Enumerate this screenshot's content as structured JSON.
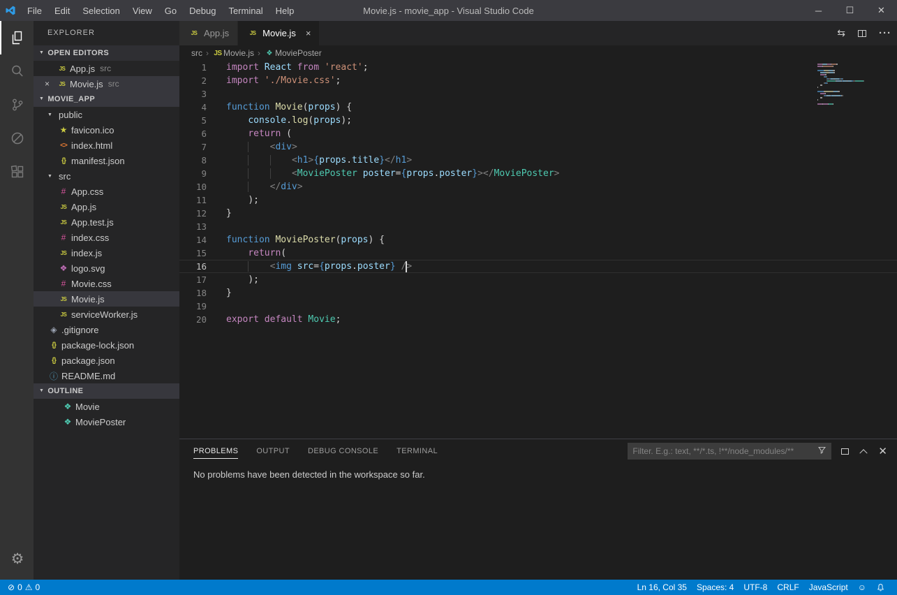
{
  "colors": {
    "accent": "#007acc",
    "editor_background": "#1e1e1e",
    "sidebar_background": "#252526",
    "activitybar_background": "#333333",
    "titlebar_background": "#3b3b40",
    "statusbar_background": "#007acc",
    "selection_background": "#37373d"
  },
  "title_bar": {
    "title": "Movie.js - movie_app - Visual Studio Code",
    "menus": [
      "File",
      "Edit",
      "Selection",
      "View",
      "Go",
      "Debug",
      "Terminal",
      "Help"
    ]
  },
  "activity_bar": {
    "items": [
      {
        "name": "explorer",
        "active": true
      },
      {
        "name": "search",
        "active": false
      },
      {
        "name": "source-control",
        "active": false
      },
      {
        "name": "debug",
        "active": false
      },
      {
        "name": "extensions",
        "active": false
      }
    ],
    "bottom": [
      {
        "name": "settings"
      }
    ]
  },
  "sidebar": {
    "title": "EXPLORER",
    "open_editors": {
      "label": "OPEN EDITORS",
      "items": [
        {
          "icon": "js",
          "label": "App.js",
          "path": "src",
          "selected": false,
          "close_visible": false
        },
        {
          "icon": "js",
          "label": "Movie.js",
          "path": "src",
          "selected": true,
          "close_visible": true
        }
      ]
    },
    "workspace": {
      "label": "MOVIE_APP",
      "items": [
        {
          "type": "folder",
          "label": "public",
          "indent": 0,
          "expanded": true
        },
        {
          "type": "file",
          "icon": "star",
          "label": "favicon.ico",
          "indent": 1
        },
        {
          "type": "file",
          "icon": "html",
          "label": "index.html",
          "indent": 1
        },
        {
          "type": "file",
          "icon": "json",
          "label": "manifest.json",
          "indent": 1
        },
        {
          "type": "folder",
          "label": "src",
          "indent": 0,
          "expanded": true
        },
        {
          "type": "file",
          "icon": "css",
          "label": "App.css",
          "indent": 1
        },
        {
          "type": "file",
          "icon": "js",
          "label": "App.js",
          "indent": 1
        },
        {
          "type": "file",
          "icon": "js",
          "label": "App.test.js",
          "indent": 1
        },
        {
          "type": "file",
          "icon": "css",
          "label": "index.css",
          "indent": 1
        },
        {
          "type": "file",
          "icon": "js",
          "label": "index.js",
          "indent": 1
        },
        {
          "type": "file",
          "icon": "svg",
          "label": "logo.svg",
          "indent": 1
        },
        {
          "type": "file",
          "icon": "css",
          "label": "Movie.css",
          "indent": 1
        },
        {
          "type": "file",
          "icon": "js",
          "label": "Movie.js",
          "indent": 1,
          "selected": true
        },
        {
          "type": "file",
          "icon": "js",
          "label": "serviceWorker.js",
          "indent": 1
        },
        {
          "type": "file",
          "icon": "git",
          "label": ".gitignore",
          "indent": 0
        },
        {
          "type": "file",
          "icon": "json",
          "label": "package-lock.json",
          "indent": 0
        },
        {
          "type": "file",
          "icon": "json",
          "label": "package.json",
          "indent": 0
        },
        {
          "type": "file",
          "icon": "info",
          "label": "README.md",
          "indent": 0
        }
      ]
    },
    "outline": {
      "label": "OUTLINE",
      "items": [
        {
          "icon": "symbol",
          "label": "Movie"
        },
        {
          "icon": "symbol",
          "label": "MoviePoster"
        }
      ]
    }
  },
  "editor": {
    "tabs": [
      {
        "icon": "js",
        "label": "App.js",
        "active": false,
        "close_visible": false
      },
      {
        "icon": "js",
        "label": "Movie.js",
        "active": true,
        "close_visible": true
      }
    ],
    "actions": [
      "open-changes",
      "split-editor",
      "more-actions"
    ],
    "breadcrumbs": [
      {
        "label": "src"
      },
      {
        "icon": "js",
        "label": "Movie.js"
      },
      {
        "icon": "symbol",
        "label": "MoviePoster"
      }
    ],
    "cursor": {
      "line": 16,
      "col": 35
    },
    "token_colors": {
      "k": "#c586c0",
      "b": "#569cd6",
      "f": "#dcdcaa",
      "v": "#9cdcfe",
      "s": "#ce9178",
      "c": "#4ec9b0",
      "g": "#808080",
      "d": "#d4d4d4"
    },
    "code": [
      {
        "n": 1,
        "t": [
          [
            "k",
            "import"
          ],
          [
            "d",
            " "
          ],
          [
            "v",
            "React"
          ],
          [
            "d",
            " "
          ],
          [
            "k",
            "from"
          ],
          [
            "d",
            " "
          ],
          [
            "s",
            "'react'"
          ],
          [
            "d",
            ";"
          ]
        ]
      },
      {
        "n": 2,
        "t": [
          [
            "k",
            "import"
          ],
          [
            "d",
            " "
          ],
          [
            "s",
            "'./Movie.css'"
          ],
          [
            "d",
            ";"
          ]
        ]
      },
      {
        "n": 3,
        "t": []
      },
      {
        "n": 4,
        "t": [
          [
            "b",
            "function"
          ],
          [
            "d",
            " "
          ],
          [
            "f",
            "Movie"
          ],
          [
            "d",
            "("
          ],
          [
            "v",
            "props"
          ],
          [
            "d",
            ") {"
          ]
        ]
      },
      {
        "n": 5,
        "t": [
          [
            "w",
            "    "
          ],
          [
            "v",
            "console"
          ],
          [
            "d",
            "."
          ],
          [
            "f",
            "log"
          ],
          [
            "d",
            "("
          ],
          [
            "v",
            "props"
          ],
          [
            "d",
            ");"
          ]
        ]
      },
      {
        "n": 6,
        "t": [
          [
            "w",
            "    "
          ],
          [
            "k",
            "return"
          ],
          [
            "d",
            " ("
          ]
        ]
      },
      {
        "n": 7,
        "t": [
          [
            "w",
            "        "
          ],
          [
            "g",
            "<"
          ],
          [
            "b",
            "div"
          ],
          [
            "g",
            ">"
          ]
        ]
      },
      {
        "n": 8,
        "t": [
          [
            "w",
            "            "
          ],
          [
            "g",
            "<"
          ],
          [
            "b",
            "h1"
          ],
          [
            "g",
            ">"
          ],
          [
            "b",
            "{"
          ],
          [
            "v",
            "props"
          ],
          [
            "d",
            "."
          ],
          [
            "v",
            "title"
          ],
          [
            "b",
            "}"
          ],
          [
            "g",
            "</"
          ],
          [
            "b",
            "h1"
          ],
          [
            "g",
            ">"
          ]
        ]
      },
      {
        "n": 9,
        "t": [
          [
            "w",
            "            "
          ],
          [
            "g",
            "<"
          ],
          [
            "c",
            "MoviePoster"
          ],
          [
            "d",
            " "
          ],
          [
            "v",
            "poster"
          ],
          [
            "d",
            "="
          ],
          [
            "b",
            "{"
          ],
          [
            "v",
            "props"
          ],
          [
            "d",
            "."
          ],
          [
            "v",
            "poster"
          ],
          [
            "b",
            "}"
          ],
          [
            "g",
            "></"
          ],
          [
            "c",
            "MoviePoster"
          ],
          [
            "g",
            ">"
          ]
        ]
      },
      {
        "n": 10,
        "t": [
          [
            "w",
            "        "
          ],
          [
            "g",
            "</"
          ],
          [
            "b",
            "div"
          ],
          [
            "g",
            ">"
          ]
        ]
      },
      {
        "n": 11,
        "t": [
          [
            "w",
            "    "
          ],
          [
            "d",
            ");"
          ]
        ]
      },
      {
        "n": 12,
        "t": [
          [
            "d",
            "}"
          ]
        ]
      },
      {
        "n": 13,
        "t": []
      },
      {
        "n": 14,
        "t": [
          [
            "b",
            "function"
          ],
          [
            "d",
            " "
          ],
          [
            "f",
            "MoviePoster"
          ],
          [
            "d",
            "("
          ],
          [
            "v",
            "props"
          ],
          [
            "d",
            ") {"
          ]
        ]
      },
      {
        "n": 15,
        "t": [
          [
            "w",
            "    "
          ],
          [
            "k",
            "return"
          ],
          [
            "d",
            "("
          ]
        ]
      },
      {
        "n": 16,
        "current": true,
        "t": [
          [
            "w",
            "        "
          ],
          [
            "g",
            "<"
          ],
          [
            "b",
            "img"
          ],
          [
            "d",
            " "
          ],
          [
            "v",
            "src"
          ],
          [
            "d",
            "="
          ],
          [
            "b",
            "{"
          ],
          [
            "v",
            "props"
          ],
          [
            "d",
            "."
          ],
          [
            "v",
            "poster"
          ],
          [
            "b",
            "}"
          ],
          [
            "d",
            " "
          ],
          [
            "g",
            "/"
          ],
          [
            "CURSOR",
            ""
          ],
          [
            "g",
            ">"
          ]
        ]
      },
      {
        "n": 17,
        "t": [
          [
            "w",
            "    "
          ],
          [
            "d",
            ");"
          ]
        ]
      },
      {
        "n": 18,
        "t": [
          [
            "d",
            "}"
          ]
        ]
      },
      {
        "n": 19,
        "t": []
      },
      {
        "n": 20,
        "t": [
          [
            "k",
            "export"
          ],
          [
            "d",
            " "
          ],
          [
            "k",
            "default"
          ],
          [
            "d",
            " "
          ],
          [
            "c",
            "Movie"
          ],
          [
            "d",
            ";"
          ]
        ]
      }
    ]
  },
  "panel": {
    "tabs": [
      {
        "label": "PROBLEMS",
        "active": true
      },
      {
        "label": "OUTPUT",
        "active": false
      },
      {
        "label": "DEBUG CONSOLE",
        "active": false
      },
      {
        "label": "TERMINAL",
        "active": false
      }
    ],
    "filter_placeholder": "Filter. E.g.: text, **/*.ts, !**/node_modules/**",
    "actions": [
      "filter",
      "panel-layout",
      "maximize-panel",
      "close-panel"
    ],
    "message": "No problems have been detected in the workspace so far."
  },
  "status_bar": {
    "errors": "0",
    "warnings": "0",
    "cursor_position": "Ln 16, Col 35",
    "indentation": "Spaces: 4",
    "encoding": "UTF-8",
    "eol": "CRLF",
    "language": "JavaScript"
  }
}
